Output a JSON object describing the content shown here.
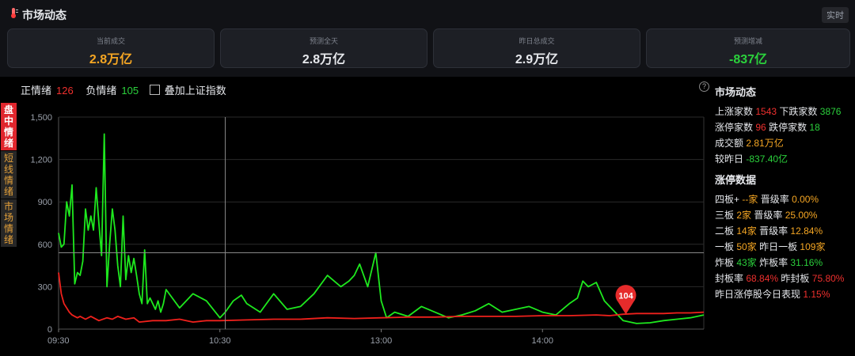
{
  "header": {
    "title": "市场动态",
    "realtime": "实时",
    "logo_icon": "thermometer-icon"
  },
  "cards": [
    {
      "label": "当前成交",
      "value": "2.8万亿",
      "color": "#f5a623"
    },
    {
      "label": "预测全天",
      "value": "2.8万亿",
      "color": "#e6e8ec"
    },
    {
      "label": "昨日总成交",
      "value": "2.9万亿",
      "color": "#e6e8ec"
    },
    {
      "label": "预测增减",
      "value": "-837亿",
      "color": "#2bd13c"
    }
  ],
  "legend": {
    "pos_label": "正情绪",
    "pos_value": "126",
    "neg_label": "负情绪",
    "neg_value": "105",
    "overlay_label": "叠加上证指数"
  },
  "tabs": [
    {
      "label": "盘中情绪"
    },
    {
      "label": "短线情绪"
    },
    {
      "label": "市场情绪"
    }
  ],
  "right_panel": {
    "market_title": "市场动态",
    "rise_label": "上涨家数",
    "rise_value": "1543",
    "fall_label": "下跌家数",
    "fall_value": "3876",
    "limitup_label": "涨停家数",
    "limitup_value": "96",
    "limitdown_label": "跌停家数",
    "limitdown_value": "18",
    "turnover_label": "成交额",
    "turnover_value": "2.81万亿",
    "vs_label": "较昨日",
    "vs_value": "-837.40亿",
    "limit_title": "涨停数据",
    "b4_label": "四板+",
    "b4_value": "--家",
    "b4_rate_label": "晋级率",
    "b4_rate": "0.00%",
    "b3_label": "三板",
    "b3_value": "2家",
    "b3_rate_label": "晋级率",
    "b3_rate": "25.00%",
    "b2_label": "二板",
    "b2_value": "14家",
    "b2_rate_label": "晋级率",
    "b2_rate": "12.84%",
    "b1_label": "一板",
    "b1_value": "50家",
    "b1_prev_label": "昨日一板",
    "b1_prev": "109家",
    "broken_label": "炸板",
    "broken_value": "43家",
    "broken_rate_label": "炸板率",
    "broken_rate": "31.16%",
    "seal_label": "封板率",
    "seal_rate": "68.84%",
    "prev_seal_label": "昨封板",
    "prev_seal": "75.80%",
    "perf_label": "昨日涨停股今日表现",
    "perf_value": "1.15%"
  },
  "chart_data": {
    "type": "line",
    "x_ticks": [
      "09:30",
      "10:30",
      "13:00",
      "14:00"
    ],
    "y_ticks": [
      "0",
      "300",
      "600",
      "900",
      "1,200",
      "1,500"
    ],
    "ylim": [
      0,
      1500
    ],
    "x_range_minutes": [
      0,
      240
    ],
    "x_tick_minutes": [
      0,
      60,
      120,
      180
    ],
    "crosshair": {
      "minute": 62,
      "y": 540
    },
    "marker": {
      "minute": 211,
      "value": 104,
      "label": "104"
    },
    "series": [
      {
        "name": "负情绪",
        "color": "#1ee81e",
        "x": [
          0,
          1,
          2,
          3,
          4,
          5,
          6,
          7,
          8,
          9,
          10,
          11,
          12,
          13,
          14,
          15,
          16,
          17,
          18,
          19,
          20,
          21,
          22,
          23,
          24,
          25,
          26,
          27,
          28,
          29,
          30,
          31,
          32,
          33,
          34,
          35,
          36,
          37,
          38,
          39,
          40,
          45,
          50,
          55,
          60,
          62,
          65,
          68,
          70,
          75,
          80,
          85,
          90,
          95,
          100,
          105,
          108,
          110,
          112,
          115,
          118,
          120,
          122,
          125,
          130,
          135,
          140,
          145,
          150,
          155,
          160,
          165,
          170,
          175,
          180,
          185,
          190,
          193,
          195,
          197,
          200,
          203,
          205,
          210,
          215,
          220,
          225,
          230,
          235,
          240
        ],
        "values": [
          680,
          580,
          600,
          900,
          800,
          1020,
          320,
          400,
          380,
          480,
          850,
          700,
          800,
          700,
          1000,
          750,
          520,
          1380,
          300,
          600,
          850,
          700,
          450,
          300,
          800,
          350,
          520,
          400,
          500,
          380,
          250,
          180,
          560,
          180,
          220,
          180,
          140,
          200,
          120,
          180,
          280,
          150,
          250,
          200,
          80,
          120,
          200,
          240,
          180,
          120,
          250,
          140,
          160,
          250,
          380,
          300,
          340,
          380,
          460,
          300,
          540,
          200,
          80,
          120,
          90,
          160,
          120,
          80,
          100,
          130,
          180,
          120,
          140,
          160,
          120,
          100,
          180,
          220,
          340,
          300,
          330,
          200,
          160,
          60,
          40,
          45,
          60,
          70,
          80,
          100
        ]
      },
      {
        "name": "正情绪",
        "color": "#f0211c",
        "x": [
          0,
          1,
          2,
          3,
          4,
          5,
          6,
          7,
          8,
          10,
          12,
          15,
          18,
          20,
          22,
          25,
          28,
          30,
          35,
          40,
          45,
          50,
          55,
          60,
          70,
          80,
          90,
          100,
          110,
          120,
          130,
          140,
          150,
          160,
          170,
          180,
          190,
          200,
          205,
          210,
          215,
          220,
          225,
          230,
          235,
          240
        ],
        "values": [
          400,
          250,
          180,
          150,
          120,
          100,
          90,
          80,
          90,
          70,
          90,
          60,
          80,
          70,
          90,
          70,
          80,
          50,
          60,
          60,
          70,
          50,
          60,
          60,
          65,
          70,
          70,
          80,
          75,
          80,
          85,
          85,
          90,
          90,
          90,
          95,
          95,
          100,
          95,
          105,
          110,
          110,
          110,
          115,
          115,
          120
        ]
      }
    ]
  }
}
